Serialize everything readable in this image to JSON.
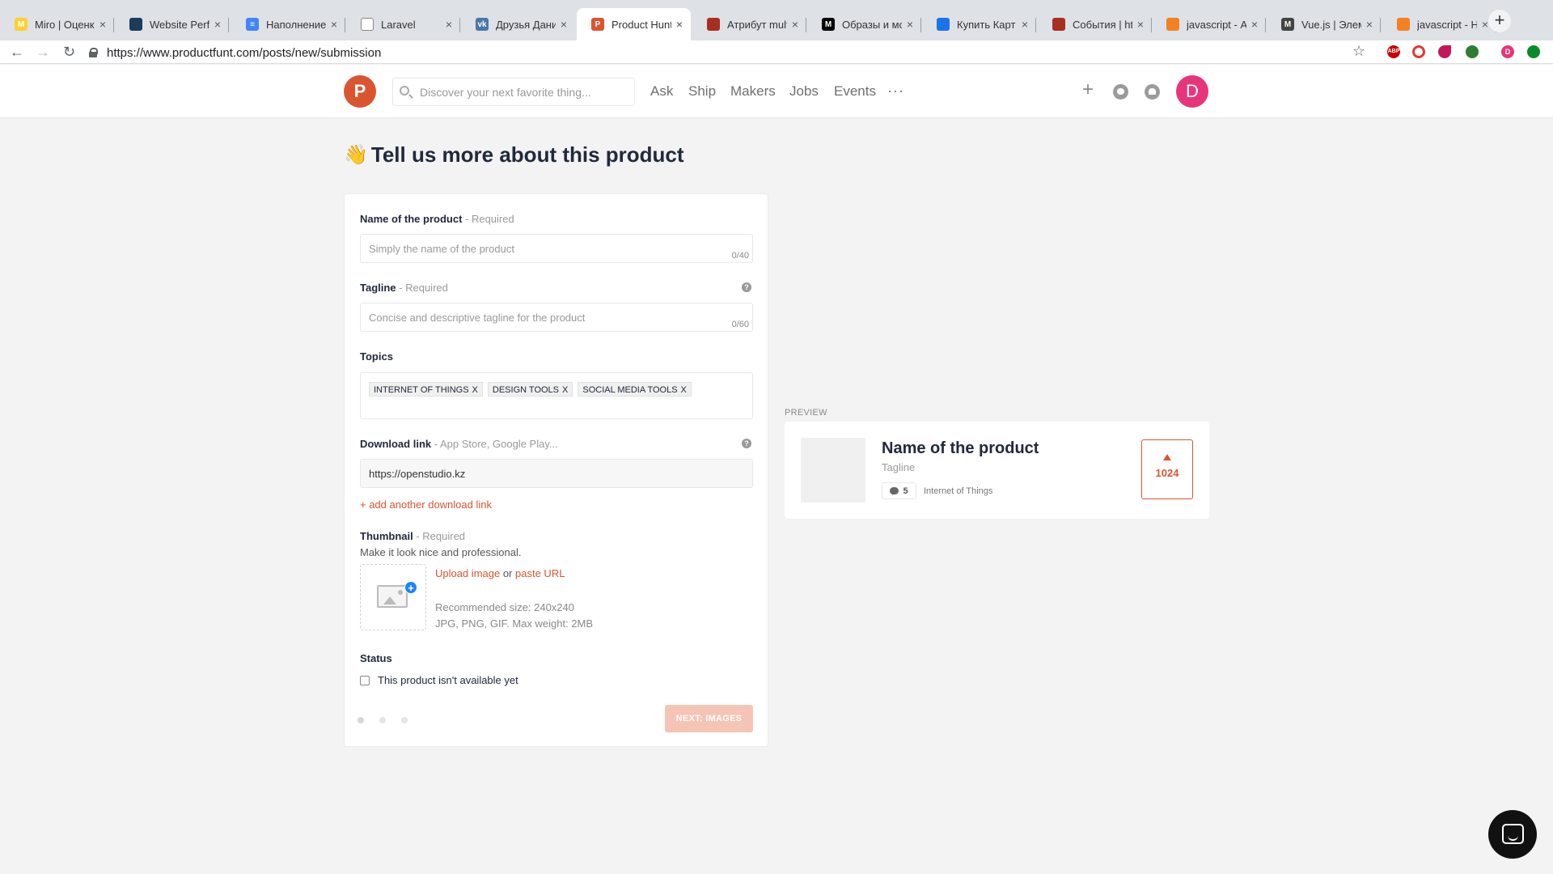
{
  "browser": {
    "tabs": [
      {
        "title": "Miro | Оценк",
        "icon": "miro-icon",
        "color": "#ffd02f",
        "glyph": "M"
      },
      {
        "title": "Website Perfo",
        "icon": "pingdom-icon",
        "color": "#1d3b5a",
        "glyph": ""
      },
      {
        "title": "Наполнение",
        "icon": "google-docs-icon",
        "color": "#4285f4",
        "glyph": "≡"
      },
      {
        "title": "Laravel",
        "icon": "document-icon",
        "color": "#ffffff",
        "glyph": ""
      },
      {
        "title": "Друзья Дани",
        "icon": "vk-icon",
        "color": "#4a76a8",
        "glyph": "vk"
      },
      {
        "title": "Product Hunt",
        "icon": "product-hunt-icon",
        "color": "#da552f",
        "glyph": "P"
      },
      {
        "title": "Атрибут mult",
        "icon": "htmlbook-icon",
        "color": "#a82f1f",
        "glyph": ""
      },
      {
        "title": "Образы и мо",
        "icon": "medium-icon",
        "color": "#000000",
        "glyph": "M"
      },
      {
        "title": "Купить Карт",
        "icon": "store-icon",
        "color": "#1a73e8",
        "glyph": ""
      },
      {
        "title": "События | htm",
        "icon": "htmlbook-icon",
        "color": "#a82f1f",
        "glyph": ""
      },
      {
        "title": "javascript - А",
        "icon": "stackoverflow-icon",
        "color": "#f48024",
        "glyph": ""
      },
      {
        "title": "Vue.js | Элем",
        "icon": "metanit-icon",
        "color": "#444444",
        "glyph": "M"
      },
      {
        "title": "javascript - Н",
        "icon": "stackoverflow-icon",
        "color": "#f48024",
        "glyph": ""
      }
    ],
    "active_tab_index": 5,
    "url": "https://www.productfunt.com/posts/new/submission"
  },
  "header": {
    "logo_letter": "P",
    "search_placeholder": "Discover your next favorite thing...",
    "nav": [
      "Ask",
      "Ship",
      "Makers",
      "Jobs",
      "Events"
    ],
    "more": "···",
    "plus": "+",
    "avatar_letter": "D",
    "accent": "#da552f",
    "avatar_color": "#e8347b"
  },
  "page": {
    "emoji": "👋",
    "title": "Tell us more about this product"
  },
  "form": {
    "name": {
      "label": "Name of the product",
      "req": " - Required",
      "placeholder": "Simply the name of the product",
      "counter": "0/40"
    },
    "tagline": {
      "label": "Tagline",
      "req": " - Required",
      "placeholder": "Concise and descriptive tagline for the product",
      "counter": "0/60",
      "help": "?"
    },
    "topics": {
      "label": "Topics",
      "chips": [
        "INTERNET OF THINGS",
        "DESIGN TOOLS",
        "SOCIAL MEDIA TOOLS"
      ],
      "remove": "X"
    },
    "download": {
      "label": "Download link",
      "req": " - App Store, Google Play...",
      "value": "https://openstudio.kz",
      "help": "?",
      "add_link": "+ add another download link"
    },
    "thumbnail": {
      "label": "Thumbnail",
      "req": " - Required",
      "sub": "Make it look nice and professional.",
      "upload": "Upload image",
      "or": " or ",
      "paste": "paste URL",
      "rec_size": "Recommended size: 240x240",
      "formats": "JPG, PNG, GIF. Max weight: 2MB"
    },
    "status": {
      "label": "Status",
      "checkbox_label": "This product isn't available yet",
      "checked": false
    },
    "steps": 3,
    "next_button": "NEXT: IMAGES"
  },
  "preview": {
    "label": "PREVIEW",
    "name": "Name of the product",
    "tagline": "Tagline",
    "comments": "5",
    "topic": "Internet of Things",
    "votes": "1024"
  }
}
